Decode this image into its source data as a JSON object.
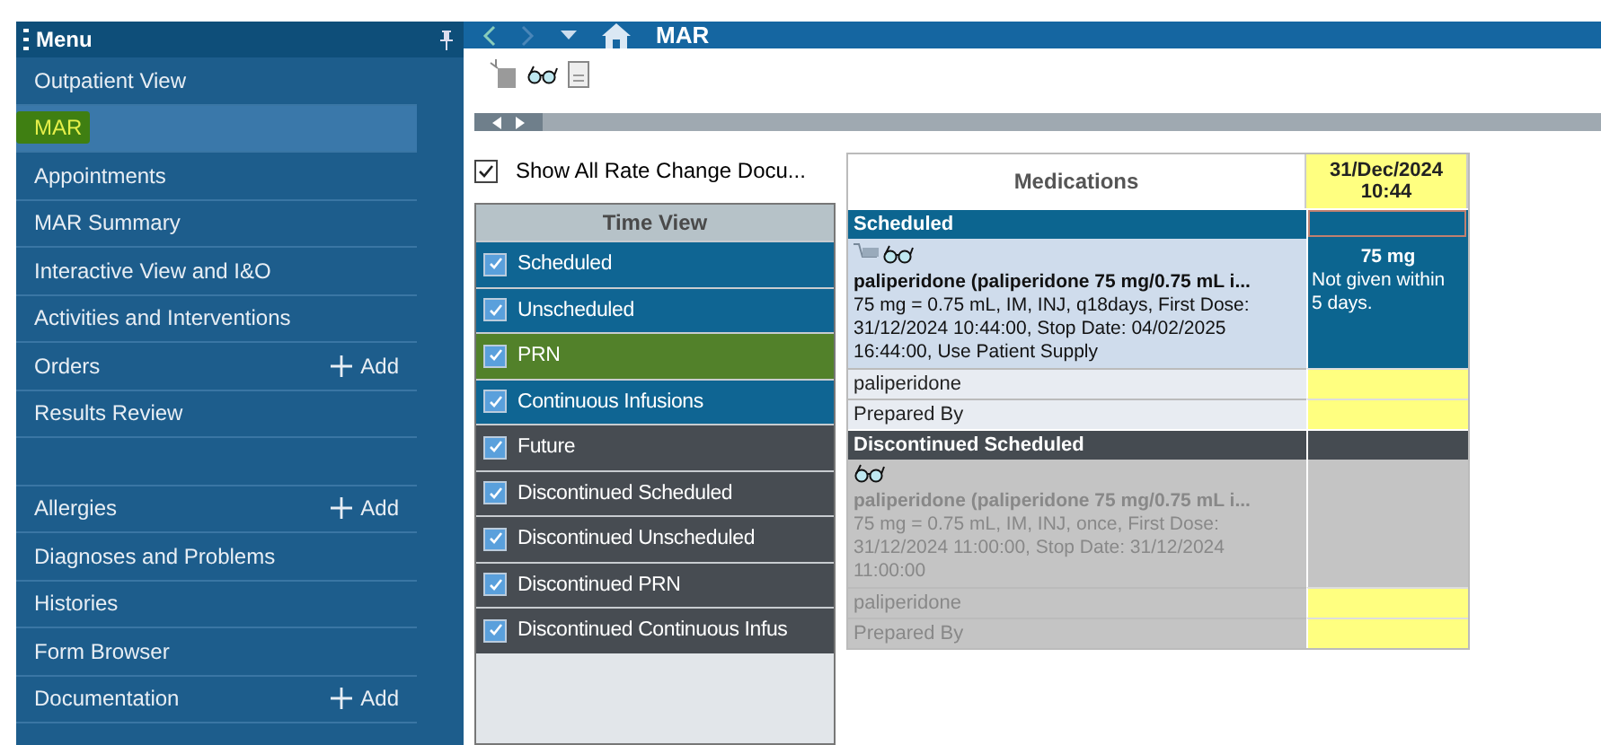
{
  "sidebar": {
    "title": "Menu",
    "items": [
      {
        "label": "Outpatient View",
        "selected": false,
        "highlighted": false
      },
      {
        "label": "MAR",
        "selected": true,
        "highlighted": true
      },
      {
        "label": "Appointments",
        "selected": false,
        "highlighted": false
      },
      {
        "label": "MAR Summary",
        "selected": false,
        "highlighted": false
      },
      {
        "label": "Interactive View and I&O",
        "selected": false,
        "highlighted": false
      },
      {
        "label": "Activities and Interventions",
        "selected": false,
        "highlighted": false
      },
      {
        "label": "Orders",
        "selected": false,
        "highlighted": false,
        "action": "Add"
      },
      {
        "label": "Results Review",
        "selected": false,
        "highlighted": false
      },
      {
        "selected": false
      },
      {
        "label": "Allergies",
        "selected": false,
        "highlighted": false,
        "action": "Add"
      },
      {
        "label": "Diagnoses and Problems",
        "selected": false,
        "highlighted": false
      },
      {
        "label": "Histories",
        "selected": false,
        "highlighted": false
      },
      {
        "label": "Form Browser",
        "selected": false,
        "highlighted": false
      },
      {
        "label": "Documentation",
        "selected": false,
        "highlighted": false,
        "action": "Add"
      }
    ]
  },
  "header": {
    "title": "MAR"
  },
  "options": {
    "show_all_rate_change": {
      "label": "Show All Rate Change Docu...",
      "checked": true
    }
  },
  "time_view": {
    "title": "Time View",
    "items": [
      {
        "label": "Scheduled",
        "checked": true,
        "color": "#0f6593"
      },
      {
        "label": "Unscheduled",
        "checked": true,
        "color": "#0f6593"
      },
      {
        "label": "PRN",
        "checked": true,
        "color": "#52812a"
      },
      {
        "label": "Continuous Infusions",
        "checked": true,
        "color": "#0f6593"
      },
      {
        "label": "Future",
        "checked": true,
        "color": "#474c52"
      },
      {
        "label": "Discontinued Scheduled",
        "checked": true,
        "color": "#474c52"
      },
      {
        "label": "Discontinued Unscheduled",
        "checked": true,
        "color": "#474c52"
      },
      {
        "label": "Discontinued PRN",
        "checked": true,
        "color": "#474c52"
      },
      {
        "label": "Discontinued Continuous Infus",
        "checked": true,
        "color": "#474c52"
      }
    ]
  },
  "grid": {
    "columns": [
      "Medications",
      "31/Dec/2024\n10:44"
    ],
    "groups": [
      {
        "title": "Scheduled",
        "discontinued": false,
        "supply_icon": true,
        "order_title": "paliperidone (paliperidone 75 mg/0.75 mL i...",
        "order_detail": "75 mg = 0.75 mL, IM, INJ, q18days, First Dose: 31/12/2024 10:44:00, Stop Date: 04/02/2025 16:44:00, Use Patient Supply",
        "cell_dose": "75 mg",
        "cell_note": "Not given within 5 days.",
        "rows": [
          "paliperidone",
          "Prepared By"
        ]
      },
      {
        "title": "Discontinued Scheduled",
        "discontinued": true,
        "supply_icon": false,
        "order_title": "paliperidone (paliperidone 75 mg/0.75 mL i...",
        "order_detail": "75 mg = 0.75 mL, IM, INJ, once, First Dose: 31/12/2024 11:00:00, Stop Date: 31/12/2024 11:00:00",
        "rows": [
          "paliperidone",
          "Prepared By"
        ]
      }
    ]
  }
}
